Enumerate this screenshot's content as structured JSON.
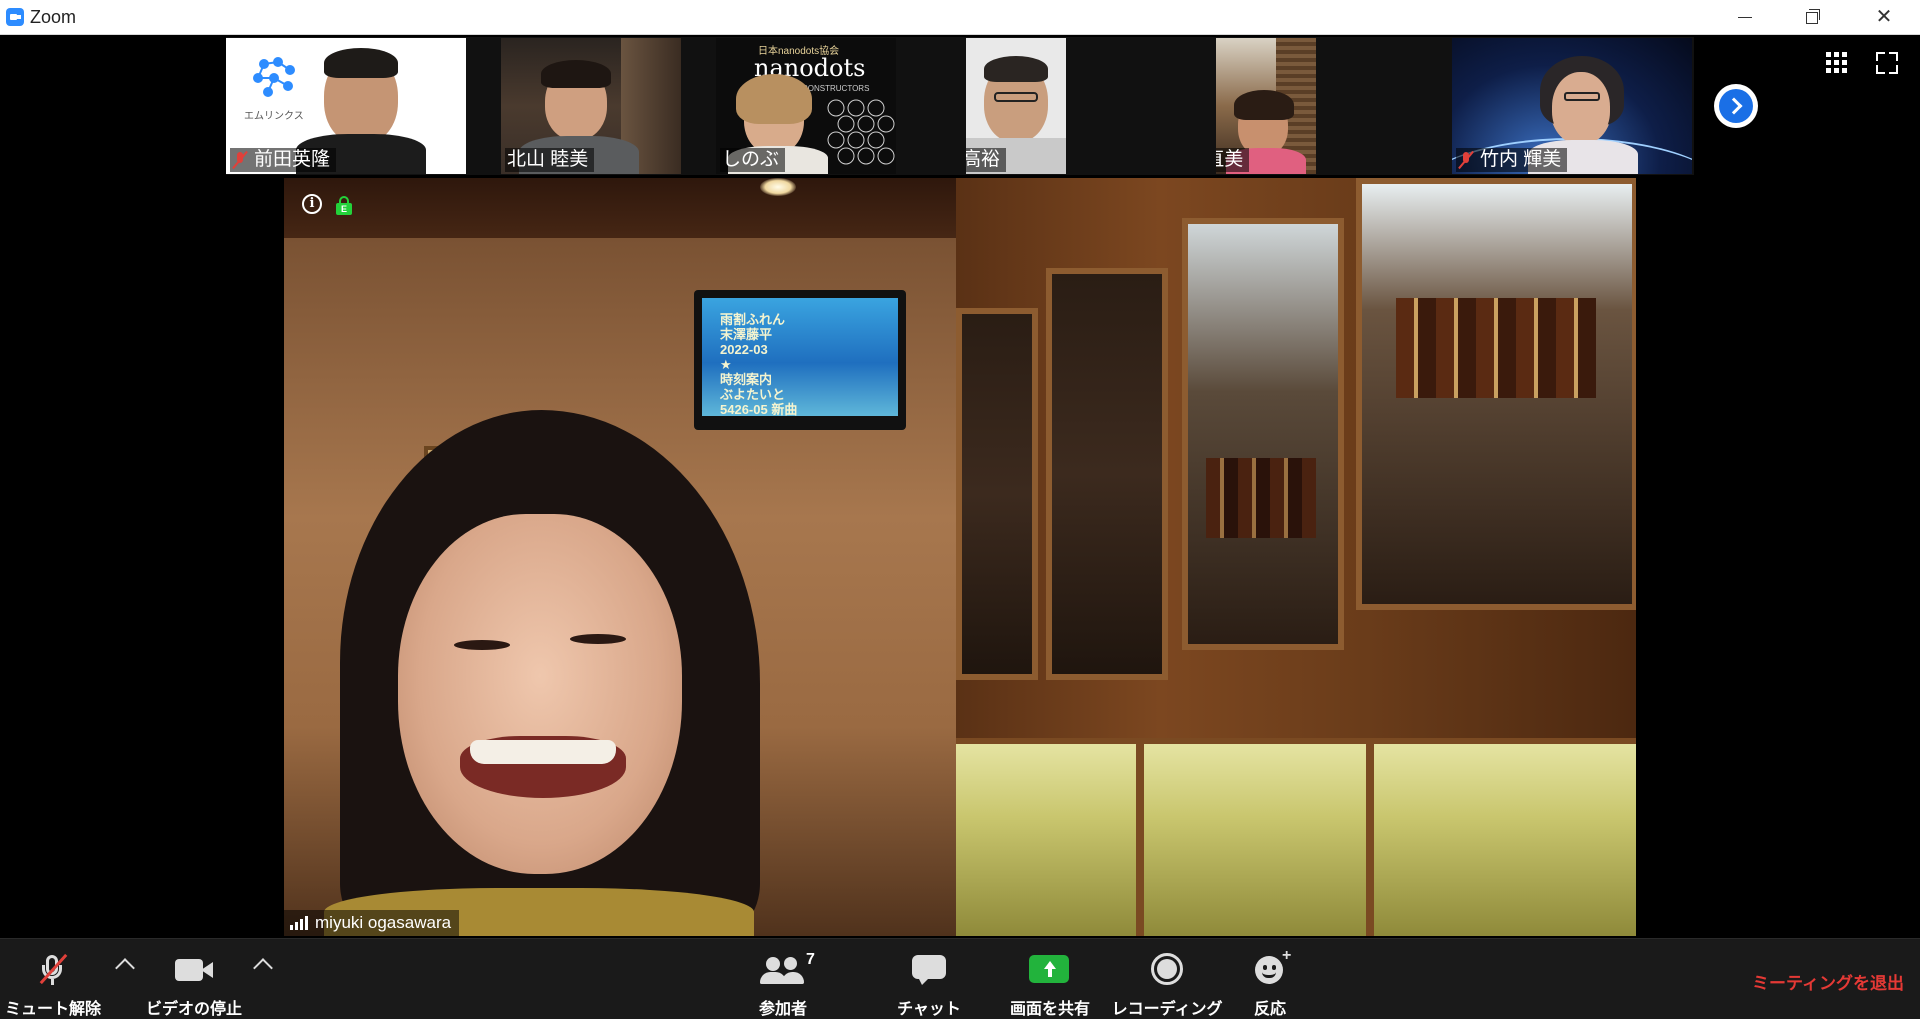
{
  "window": {
    "title": "Zoom"
  },
  "thumbnails": [
    {
      "name": "前田英隆",
      "muted": true
    },
    {
      "name": "北山 睦美",
      "muted": false
    },
    {
      "name": "しのぶ",
      "muted": false,
      "bg_text": "日本nanodots協会",
      "bg_logo": "nanodots",
      "bg_sub": "CONSTRUCTORS"
    },
    {
      "name": "末次高裕",
      "muted": false
    },
    {
      "name": "木原 直美",
      "muted": false
    },
    {
      "name": "竹内 輝美",
      "muted": true
    }
  ],
  "thumb1_logo_text": "エムリンクス",
  "main_video": {
    "speaker_name": "miyuki ogasawara",
    "tv_text": "雨割ふれん\n末澤藤平\n2022-03\n★\n時刻案内\nぶよたいと\n5426-05 新曲"
  },
  "toolbar": {
    "unmute_label": "ミュート解除",
    "stop_video_label": "ビデオの停止",
    "participants_label": "参加者",
    "participants_count": "7",
    "chat_label": "チャット",
    "share_label": "画面を共有",
    "record_label": "レコーディング",
    "reactions_label": "反応",
    "leave_label": "ミーティングを退出"
  },
  "colors": {
    "accent_blue": "#2d8cff",
    "share_green": "#22b33c",
    "muted_red": "#e0403a",
    "leave_red": "#e53935",
    "encrypt_green": "#23d23a"
  }
}
